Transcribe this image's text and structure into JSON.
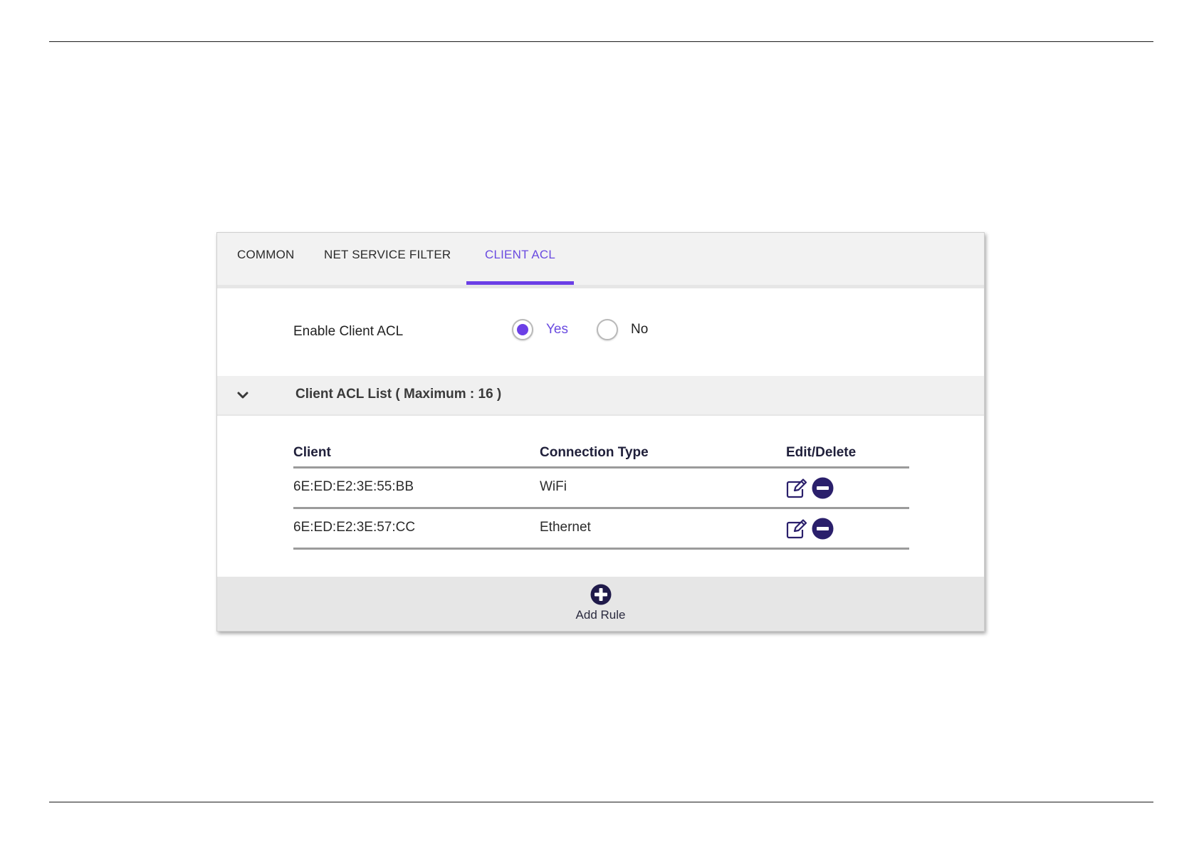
{
  "tabs": [
    {
      "label": "COMMON",
      "active": false
    },
    {
      "label": "NET SERVICE FILTER",
      "active": false
    },
    {
      "label": "CLIENT ACL",
      "active": true
    }
  ],
  "enable": {
    "label": "Enable Client ACL",
    "options": [
      {
        "label": "Yes",
        "selected": true
      },
      {
        "label": "No",
        "selected": false
      }
    ]
  },
  "section": {
    "title": "Client ACL List ( Maximum : 16 )",
    "expanded": true,
    "icon": "chevron-down-icon"
  },
  "table": {
    "headers": {
      "client": "Client",
      "connection": "Connection Type",
      "actions": "Edit/Delete"
    },
    "rows": [
      {
        "client": "6E:ED:E2:3E:55:BB",
        "connection": "WiFi"
      },
      {
        "client": "6E:ED:E2:3E:57:CC",
        "connection": "Ethernet"
      }
    ]
  },
  "footer": {
    "add_label": "Add Rule",
    "icon": "plus-circle-icon"
  },
  "colors": {
    "accent": "#6b3fe6",
    "icon_dark": "#2a1f6b"
  }
}
